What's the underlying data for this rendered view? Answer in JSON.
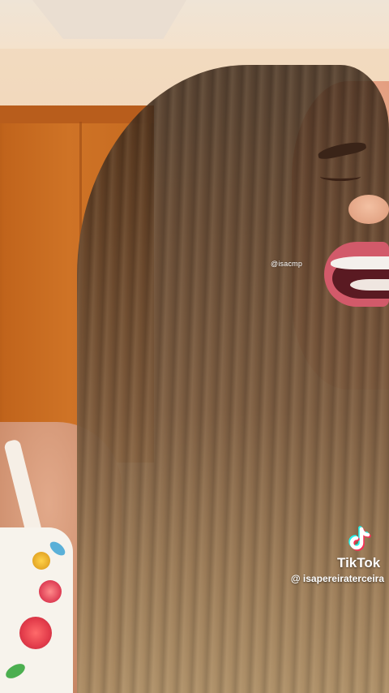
{
  "overlay": {
    "small_watermark": "@isacmp",
    "brand_name": "TikTok",
    "handle": "@ isapereiraterceira"
  },
  "icons": {
    "brand_logo": "tiktok-note-icon"
  },
  "colors": {
    "logo_cyan": "#25F4EE",
    "logo_red": "#FE2C55",
    "logo_white": "#FFFFFF"
  }
}
